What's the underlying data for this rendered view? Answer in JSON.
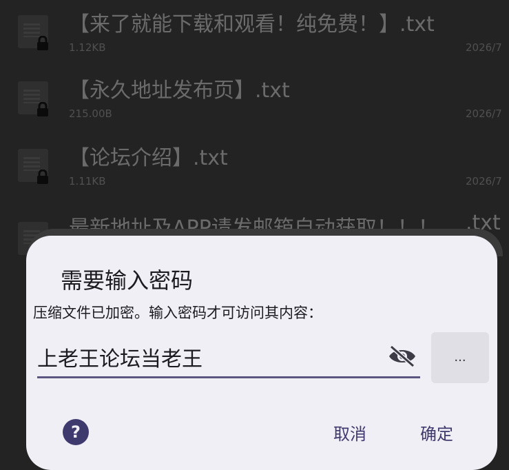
{
  "files": [
    {
      "name": "【来了就能下载和观看！纯免费！】.txt",
      "size": "1.12KB",
      "date": "2026/7"
    },
    {
      "name": "【永久地址发布页】.txt",
      "size": "215.00B",
      "date": "2026/7"
    },
    {
      "name": "【论坛介绍】.txt",
      "size": "1.11KB",
      "date": "2026/7"
    },
    {
      "name": "最新地址及APP请发邮箱自动获取！！！",
      "ext": ".txt"
    }
  ],
  "dialog": {
    "title": "需要输入密码",
    "message": "压缩文件已加密。输入密码才可访问其内容：",
    "password_value": "上老王论坛当老王",
    "more_label": "...",
    "cancel_label": "取消",
    "ok_label": "确定",
    "accent_color": "#3f3a6e"
  },
  "icons": {
    "file": "archive-file-icon",
    "lock": "lock-icon",
    "visibility": "eye-off-icon",
    "help": "help-icon"
  }
}
